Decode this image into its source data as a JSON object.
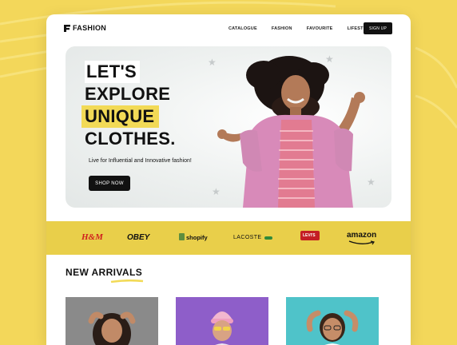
{
  "brand": {
    "name": "FASHION"
  },
  "nav": {
    "items": [
      {
        "label": "CATALOGUE"
      },
      {
        "label": "FASHION"
      },
      {
        "label": "FAVOURITE"
      },
      {
        "label": "LIFESTYLE"
      }
    ],
    "signup_label": "SIGN UP"
  },
  "hero": {
    "line1": "LET'S",
    "line2": "EXPLORE",
    "line3": "UNIQUE",
    "line4": "CLOTHES.",
    "tagline": "Live for Influential and Innovative fashion!",
    "cta_label": "SHOP NOW"
  },
  "brands": [
    {
      "name": "H&M",
      "color": "#d01e1e"
    },
    {
      "name": "OBEY",
      "color": "#111111"
    },
    {
      "name": "shopify",
      "color": "#111111"
    },
    {
      "name": "LACOSTE",
      "color": "#111111"
    },
    {
      "name": "LEVI'S",
      "color": "#c41e24"
    },
    {
      "name": "amazon",
      "color": "#111111"
    }
  ],
  "new_arrivals": {
    "title": "NEW ARRIVALS",
    "cards": [
      {
        "bg": "#8a8a8a",
        "accent": "#e97b2c"
      },
      {
        "bg": "#8e5ec9",
        "accent": "#f2b7cf"
      },
      {
        "bg": "#4fc3c9",
        "accent": "#ffffff"
      }
    ]
  },
  "colors": {
    "background": "#f3d75a",
    "accent_yellow": "#f2da56",
    "brand_bar": "#e9cf4a",
    "dark": "#111111"
  }
}
